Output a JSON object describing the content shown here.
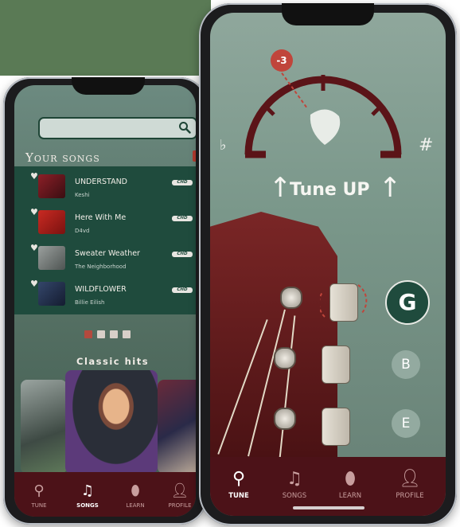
{
  "left_screen": {
    "search": {
      "placeholder": ""
    },
    "your_songs_title": "Your songs",
    "songs": [
      {
        "title": "UNDERSTAND",
        "artist": "Keshi",
        "badge": "CHD",
        "cover_color": "#7a1e24"
      },
      {
        "title": "Here With Me",
        "artist": "D4vd",
        "badge": "CHD",
        "cover_color": "#b0231f"
      },
      {
        "title": "Sweater Weather",
        "artist": "The Neighborhood",
        "badge": "CHD",
        "cover_color": "#6e7472"
      },
      {
        "title": "WILDFLOWER",
        "artist": "Billie Eilish",
        "badge": "CHD",
        "cover_color": "#26344e"
      }
    ],
    "classic_hits_title": "Classic hits",
    "nav": [
      {
        "label": "TUNE",
        "icon": "tuning-fork-icon"
      },
      {
        "label": "SONGS",
        "icon": "music-note-icon",
        "active": true
      },
      {
        "label": "LEARN",
        "icon": "guitar-pick-icon"
      },
      {
        "label": "PROFILE",
        "icon": "person-icon"
      }
    ]
  },
  "right_screen": {
    "offset_badge": "-3",
    "flat_symbol": "♭",
    "sharp_symbol": "#",
    "tune_label": "Tune UP",
    "notes": [
      "G",
      "B",
      "E"
    ],
    "selected_note": "G",
    "nav": [
      {
        "label": "TUNE",
        "icon": "tuning-fork-icon",
        "active": true
      },
      {
        "label": "SONGS",
        "icon": "music-note-icon"
      },
      {
        "label": "LEARN",
        "icon": "guitar-pick-icon"
      },
      {
        "label": "PROFILE",
        "icon": "person-icon"
      }
    ]
  },
  "colors": {
    "green_dark": "#1f4b3d",
    "maroon": "#4c1218",
    "accent_red": "#c0453b",
    "dial_color": "#5b1418"
  }
}
